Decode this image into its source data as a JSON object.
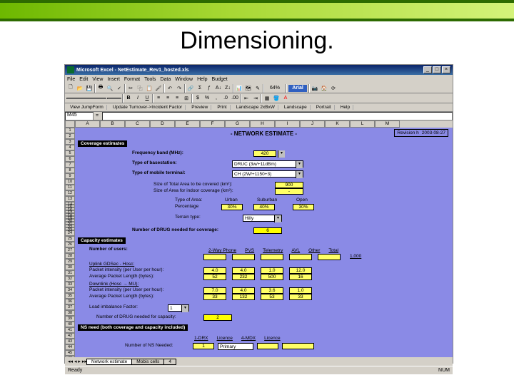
{
  "slide": {
    "title": "Dimensioning."
  },
  "app": {
    "title": "Microsoft Excel - NetEstimate_Rev1_hosted.xls",
    "menu": [
      "File",
      "Edit",
      "View",
      "Insert",
      "Format",
      "Tools",
      "Data",
      "Window",
      "Help",
      "Budget"
    ],
    "toolbar_row3": [
      "View JumpForm",
      "Update Turnover->Incident Factor",
      "Preview",
      "Print",
      "Landscape 2xBxW",
      "Landscape",
      "Portrait",
      "Help"
    ],
    "namebox": "M45",
    "columns": [
      "A",
      "B",
      "C",
      "D",
      "E",
      "F",
      "G",
      "H",
      "I",
      "J",
      "K",
      "L",
      "M"
    ],
    "row_start": 1,
    "row_end": 48
  },
  "net": {
    "title": "- NETWORK ESTIMATE -",
    "revision_lbl": "Revision h",
    "revision_date": "2003-08-27",
    "cov_hdr": "Coverage estimates",
    "freq_lbl": "Frequency band (MHz):",
    "freq_val": "420",
    "bs_lbl": "Type of basestation:",
    "bs_val": "DRUC (3w/+11dBm)",
    "mt_lbl": "Type of mobile terminal:",
    "mt_val": "CH (2W/+1150+3)",
    "total_area_lbl": "Size of Total Area to be covered (km²):",
    "total_area_val": "900",
    "indoor_lbl": "Size of Area for indoor coverage (km²):",
    "indoor_val": "-",
    "type_area_lbl": "Type of Area:",
    "type_area_urban": "Urban",
    "type_area_sub": "Suburban",
    "type_area_open": "Open",
    "pct_lbl": "Percentage",
    "pct_urban": "30%",
    "pct_sub": "40%",
    "pct_open": "30%",
    "terrain_lbl": "Terrain type:",
    "terrain_val": "Hilly",
    "drug_lbl": "Number of DRUG needed for coverage:",
    "drug_val": "6",
    "cap_hdr": "Capacity estimates",
    "users_lbl": "Number of users:",
    "cap_cols": [
      "2-Way Phone",
      "PVS",
      "Telemetry",
      "AVL",
      "Other",
      "Total"
    ],
    "users_total": "1,000",
    "up_hosc": "Uplink GDSec - Hosc:",
    "up_pkt_lbl": "Packet intensity (per User per hour):",
    "up_pkt": [
      "4.0",
      "4.0",
      "1.0",
      "12.0"
    ],
    "up_len_lbl": "Average Packet Length (bytes):",
    "up_len": [
      "52",
      "232",
      "500",
      "16"
    ],
    "dn_hosc": "Downlink (Hosc → MU):",
    "dn_pkt_lbl": "Packet intensity (per User per hour):",
    "dn_pkt": [
      "7.0",
      "4.0",
      "3.6",
      "1.0"
    ],
    "dn_len_lbl": "Average Packet Length (bytes):",
    "dn_len": [
      "33",
      "132",
      "53",
      "33"
    ],
    "imb_lbl": "Load imbalance Factor:",
    "imb_val": "1",
    "drug_cap_lbl": "Number of DRUG needed for capacity:",
    "drug_cap_val": "2",
    "ns_hdr": "NS need (both coverage and capacity included)",
    "ns_cols": [
      "1-DRX",
      "Licence",
      "4-MDX",
      "Licence"
    ],
    "ns_lbl": "Number of NS Needed:",
    "ns_val": "1",
    "ns_lic": "Primary"
  },
  "tabs": {
    "t1": "Network estimate",
    "t2": "Mobis cells",
    "t3": "4"
  },
  "status": {
    "ready": "Ready",
    "num": "NUM"
  }
}
